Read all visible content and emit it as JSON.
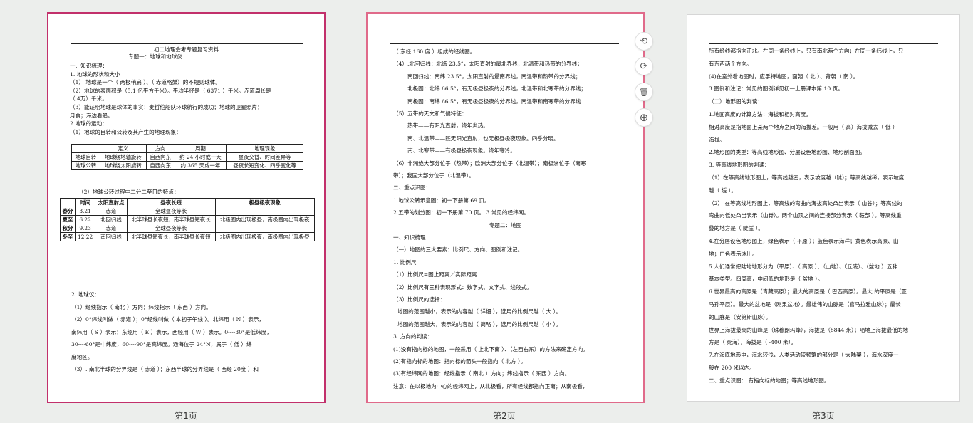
{
  "pages": [
    {
      "label": "第1页"
    },
    {
      "label": "第2页"
    },
    {
      "label": "第3页"
    }
  ],
  "toolbar": {
    "rotate_left": "⟲",
    "rotate_right": "⟳",
    "delete": "🗑",
    "add": "⊕"
  },
  "p1": {
    "title": "初二地理会考专题复习资料",
    "subtitle": "专题一：地球和地球仪",
    "lines": [
      "一、知识梳理：",
      "1. 地球的形状和大小",
      "（1） 地球是一个（ 两极稍扁 ）、（ 赤道略鼓）的不规则球体。",
      "（2）地球的表面积是（5.1 亿平方千米）。平均半径是（ 6371 ）千米。赤道周长是",
      "（ 4万）千米。",
      "（3）能证明地球是球体的事实：麦哲伦船队环球航行的成功；地球的卫星照片；",
      "月食；海边看船。",
      "2.地球的运动：",
      "（1）地球的自转和公转及其产生的地理现象："
    ],
    "t1": {
      "head": [
        "",
        "定义",
        "方向",
        "周期",
        "地理现象"
      ],
      "rows": [
        [
          "地球自转",
          "地球绕地轴旋转",
          "自西向东",
          "约 24 小时或一天",
          "昼夜交替、时间差异等"
        ],
        [
          "地球公转",
          "地球绕太阳旋转",
          "自西向东",
          "约 365 天或一年",
          "昼夜长短变化、四季变化等"
        ]
      ]
    },
    "t2cap": "（2）地球公转过程中二分二至日的特点：",
    "t2": {
      "head": [
        "",
        "时间",
        "太阳直射点",
        "昼夜长短",
        "极昼极夜现象"
      ],
      "rows": [
        [
          "春分",
          "3.21",
          "赤道",
          "全球昼夜等长",
          ""
        ],
        [
          "夏至",
          "6.22",
          "北回归线",
          "北半球昼长夜短，南半球昼短夜长",
          "北极圈内出现极昼，南极圈内出现极夜"
        ],
        [
          "秋分",
          "9.23",
          "赤道",
          "全球昼夜等长",
          ""
        ],
        [
          "冬至",
          "12.22",
          "南回归线",
          "北半球昼短夜长，南半球昼长夜短",
          "北极圈内出现极夜，南极圈内出现极昼"
        ]
      ]
    },
    "tail": [
      "2. 地球仪：",
      "（1）经线指示（ 南北 ）方向；纬线指示（ 东西 ）方向。",
      "（2）0°纬线叫做（ 赤道 ）；0°经线叫做（ 本初子午线 ）。北纬用（ N ）表示，",
      "南纬用（ S ）表示；东经用（ E ）表示，西经用（ W ）表示。0----30°是低纬度，",
      "30----60°是中纬度，60----90°是高纬度。通海位于 24°N，属于（ 低 ）纬",
      "度地区。",
      "（3）. 南北半球的分界线是（ 赤道 ）；东西半球的分界线是（ 西经 20度 ）和"
    ]
  },
  "p2": {
    "lines": [
      "（ 东经 160 度 ）组成的经线圈。",
      "（4）.北回归线：北纬 23.5°，太阳直射的最北界线，北温带和热带的分界线；",
      "南回归线：南纬 23.5°，太阳直射的最南界线，南温带和热带的分界线；",
      "北极圈：北纬 66.5°，有无极昼极夜的分界线，北温带和北寒带的分界线；",
      "南极圈：南纬 66.5°，有无极昼极夜的分界线，南温带和南寒带的分界线",
      "（5）五带的天文和气候特征：",
      "热带——有阳光直射，终年炎热。",
      "南、北温带——既无阳光直射，也无极昼极夜现象。四季分明。",
      "南、北寒带——有极昼极夜现象。终年寒冷。",
      "（6）非洲绝大部分位于（热带）；欧洲大部分位于（北温带）；南极洲位于（南寒",
      "带）；我国大部分位于（北温带）。",
      "二、重点识图：",
      "1.地球公转示意图：初一下册第 69 页。",
      "2.五带的划分图：初一下册第 70 页。 3.常见的经纬网。",
      "专题二：地图",
      "一、知识梳理",
      "（一）地图的三大要素：比例尺、方向、图例和注记。",
      "1. 比例尺",
      "（1）比例尺=图上距离／实际距离",
      "（2）比例尺有三种表现形式：数字式、文字式、线段式。",
      "（3）比例尺的选择：",
      "地图的范围越小，表示的内容越（ 详细 ），选用的比例尺越（ 大 ）。",
      "地图的范围越大，表示的内容越（ 简略 ），选用的比例尺越（ 小 ）。",
      "3. 方向的判读：",
      "(1)没有指向标的地图，一般采用（ 上北下南 ）、（左西右东）的方法来确定方向。",
      "(2)有指向标的地图：指向标的箭头一般指向（ 北方 ）。",
      "(3)有经纬网的地图：经线指示（ 南北 ）方向；纬线指示（ 东西 ）方向。",
      "注意：在以极地为中心的经纬网上，从北极看，所有经线都指向正南；从南极看，"
    ]
  },
  "p3": {
    "lines": [
      "所有经线都指向正北。在同一条经线上，只有南北两个方向；在同一条纬线上，只",
      "有东西两个方向。",
      "(4)在室外看地图时，应手持地图，面朝（ 北 ）、背朝（ 南 ）。",
      "3.图例和注记：常见的图例详见初一上册课本第 10 页。",
      "（二）地形图的判读：",
      "1.地面高度的计算方法：海拔和相对高度。",
      "相对高度是指地面上某两个地点之间的海拔差。一般用（ 高）海拔减去（ 低 ）",
      "海拔。",
      "2.地形图的类型：等高线地形图、分层设色地形图、地形剖面图。",
      "3. 等高线地形图的判读：",
      "（1）在等高线地形图上，等高线越密，表示坡度越（陡）；等高线越稀，表示坡度",
      "越（ 缓 ）。",
      "（2） 在等高线地形图上，等高线的弯曲向海拔高处凸出表示（ 山谷）；等高线的",
      "弯曲向低处凸出表示（山脊）。两个山顶之间的连接部分表示（ 鞍部 ）。等高线重",
      "叠的地方是（ 陡崖 ）。",
      "4.在分层设色地形图上，绿色表示（ 平原 ）；蓝色表示海洋；黄色表示高原、山",
      "地；白色表示冰川。",
      "5.人们通常把陆地地形分为（平原）、（ 高原 ）、（山地）、（丘陵）、（盆地 ）五种",
      "基本类型。四周高，中间低的地形是（ 盆地 ）。",
      "6.世界最高的高原是（青藏高原）；最大的高原是（ 巴西高原）。最大 的平原是（亚",
      "马孙平原）。最大的盆地是（刚果盆地）。最雄伟的山脉是（喜马拉雅山脉）；最长",
      "的山脉是（安第斯山脉）。",
      "世界上海拔最高的山峰是（珠穆朗玛峰），海拔是（8844 米）；陆地上海拔最低的地",
      "方是（ 死海），海拔是（ -400 米）。",
      "7.在海底地形中，海水较浅，人类活动较频繁的部分是（ 大陆架 ），海水深度一",
      "般在 200 米以内。",
      "二、重点识图：   有指向标的地图；等高线地形图。"
    ]
  }
}
